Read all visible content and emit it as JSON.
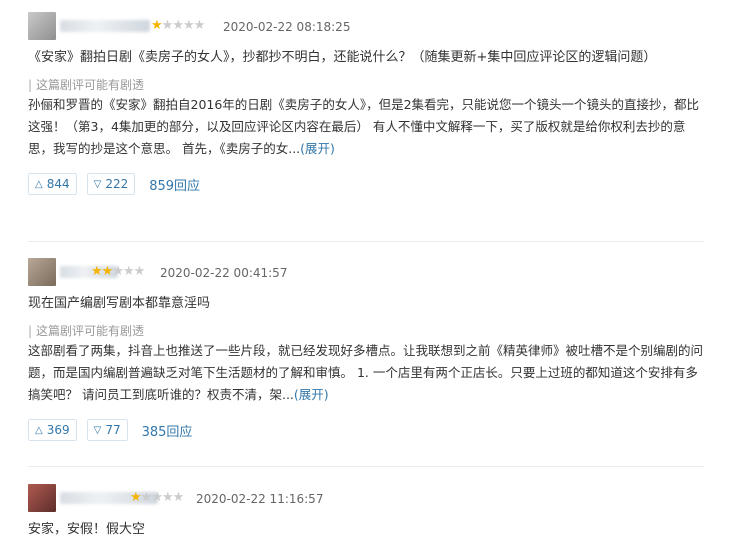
{
  "reviews": [
    {
      "stars_filled": 1,
      "stars_total": 5,
      "time": "2020-02-22 08:18:25",
      "title": "《安家》翻拍日剧《卖房子的女人》，抄都抄不明白，还能说什么？（随集更新+集中回应评论区的逻辑问题）",
      "spoiler": "这篇剧评可能有剧透",
      "body": "孙俪和罗晋的《安家》翻拍自2016年的日剧《卖房子的女人》，但是2集看完，只能说您一个镜头一个镜头的直接抄，都比这强！（第3，4集加更的部分，以及回应评论区内容在最后） 有人不懂中文解释一下，买了版权就是给你权利去抄的意思，我写的抄是这个意思。 首先，《卖房子的女...",
      "expand_label": "(展开)",
      "up_count": "844",
      "down_count": "222",
      "reply_label": "859回应"
    },
    {
      "stars_filled": 2,
      "stars_total": 5,
      "time": "2020-02-22 00:41:57",
      "title": "现在国产编剧写剧本都靠意淫吗",
      "spoiler": "这篇剧评可能有剧透",
      "body": "这部剧看了两集，抖音上也推送了一些片段，就已经发现好多槽点。让我联想到之前《精英律师》被吐槽不是个别编剧的问题，而是国内编剧普遍缺乏对笔下生活题材的了解和审慎。 1. 一个店里有两个正店长。只要上过班的都知道这个安排有多搞笑吧？ 请问员工到底听谁的？权责不清，架...",
      "expand_label": "(展开)",
      "up_count": "369",
      "down_count": "77",
      "reply_label": "385回应"
    },
    {
      "stars_filled": 1,
      "stars_total": 5,
      "time": "2020-02-22 11:16:57",
      "title": "安家，安假！假大空"
    }
  ],
  "colors": {
    "link": "#3377aa",
    "star": "#f4b400",
    "meta": "#666666"
  }
}
